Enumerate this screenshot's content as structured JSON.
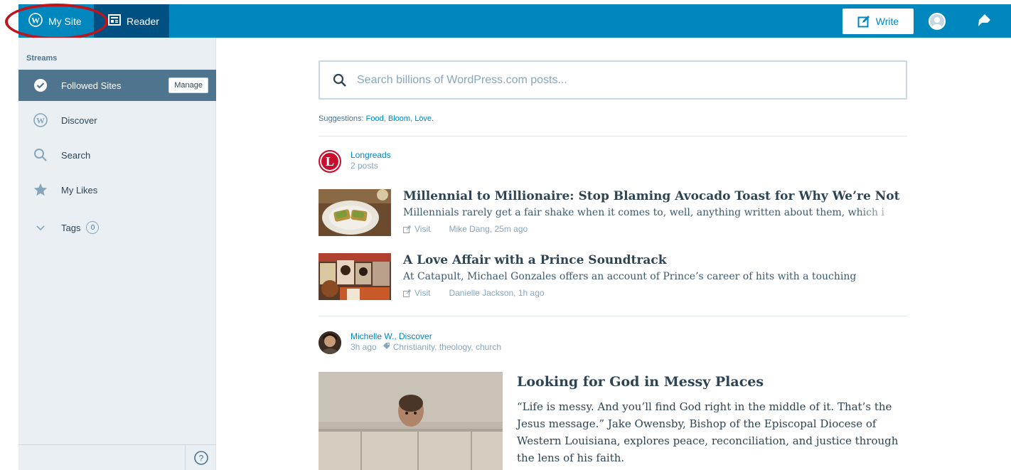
{
  "topbar": {
    "my_site_label": "My Site",
    "reader_label": "Reader",
    "write_label": "Write",
    "accent_color": "#0087be"
  },
  "sidebar": {
    "streams_label": "Streams",
    "items": [
      {
        "label": "Followed Sites",
        "icon": "checkmark-circle-icon",
        "active": true
      },
      {
        "label": "Discover",
        "icon": "wordpress-icon"
      },
      {
        "label": "Search",
        "icon": "search-icon"
      },
      {
        "label": "My Likes",
        "icon": "star-icon"
      },
      {
        "label": "Tags",
        "icon": "chevron-down-icon"
      }
    ],
    "manage_label": "Manage",
    "tags_count": "0"
  },
  "main": {
    "search_placeholder": "Search billions of WordPress.com posts...",
    "suggestions_label": "Suggestions:",
    "suggestions": [
      "Food",
      "Bloom",
      "Love."
    ],
    "site": {
      "name": "Longreads",
      "sub": "2 posts",
      "logo_letter": "L"
    },
    "posts": [
      {
        "title": "Millennial to Millionaire: Stop Blaming Avocado Toast for Why We’re Not",
        "excerpt": "Millennials rarely get a fair shake when it comes to, well, anything written about them, which i",
        "visit": "Visit",
        "byline": "Mike Dang, 25m ago"
      },
      {
        "title": "A Love Affair with a Prince Soundtrack",
        "excerpt": "At Catapult, Michael Gonzales offers an account of Prince’s career of hits with a touching",
        "visit": "Visit",
        "byline": "Danielle Jackson, 1h ago"
      }
    ],
    "discover": {
      "author": "Michelle W., Discover",
      "time": "3h ago",
      "tags": "Christianity, theology, church",
      "title": "Looking for God in Messy Places",
      "excerpt": "“Life is messy. And you’ll find God right in the middle of it. That’s the Jesus message.” Jake Owensby, Bishop of the Episcopal Diocese of Western Louisiana, explores peace, reconciliation, and justice through the lens of his faith."
    }
  }
}
